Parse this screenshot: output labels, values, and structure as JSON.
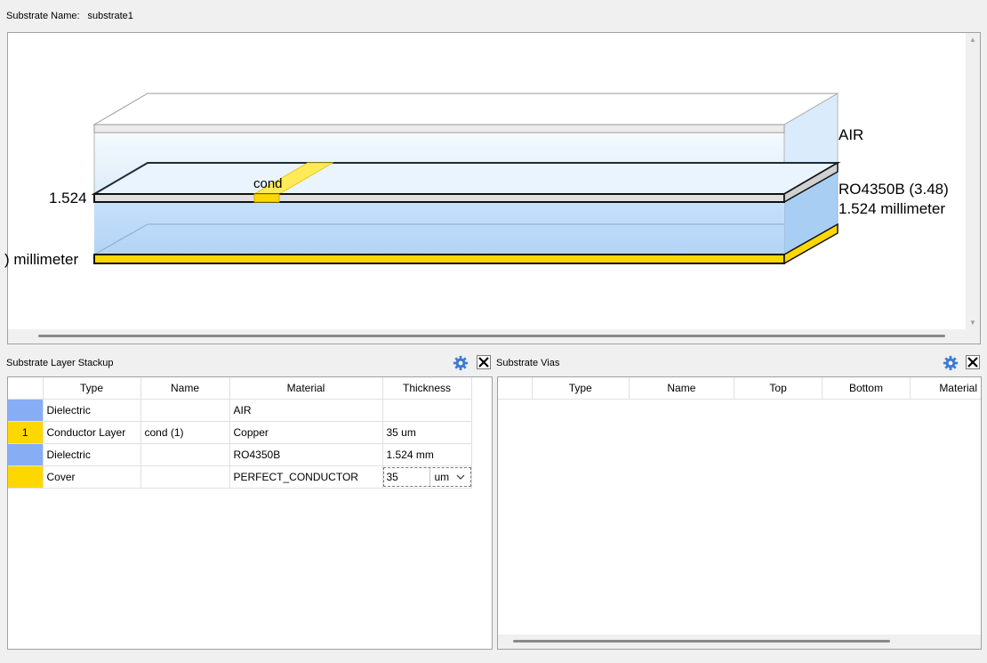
{
  "substrate": {
    "name_label": "Substrate Name:",
    "name_value": "substrate1"
  },
  "viewer": {
    "labels": {
      "air": "AIR",
      "dielectric": "RO4350B (3.48)",
      "dielectric_thickness": "1.524 millimeter",
      "left_thickness": "1.524",
      "bottom_thickness": ") millimeter",
      "conductor": "cond"
    }
  },
  "stackup": {
    "title": "Substrate Layer Stackup",
    "columns": [
      "Type",
      "Name",
      "Material",
      "Thickness"
    ],
    "rows": [
      {
        "index": "",
        "color": "#87aef5",
        "type": "Dielectric",
        "name": "",
        "material": "AIR",
        "thickness": ""
      },
      {
        "index": "1",
        "color": "#ffd700",
        "type": "Conductor Layer",
        "name": "cond (1)",
        "material": "Copper",
        "thickness": "35 um"
      },
      {
        "index": "",
        "color": "#87aef5",
        "type": "Dielectric",
        "name": "",
        "material": "RO4350B",
        "thickness": "1.524 mm"
      },
      {
        "index": "",
        "color": "#ffd700",
        "type": "Cover",
        "name": "",
        "material": "PERFECT_CONDUCTOR",
        "thickness_value": "35",
        "thickness_unit": "um"
      }
    ]
  },
  "vias": {
    "title": "Substrate Vias",
    "columns": [
      "Type",
      "Name",
      "Top",
      "Bottom",
      "Material"
    ]
  },
  "icons": {
    "gear": "gear-icon",
    "close": "close-icon",
    "chevron": "chevron-down-icon",
    "scroll_up": "scroll-up-arrow-icon",
    "scroll_down": "scroll-down-arrow-icon"
  },
  "colors": {
    "accent": "#3d7bd6",
    "conductor": "#ffd700",
    "dielectric": "#87aef5"
  }
}
